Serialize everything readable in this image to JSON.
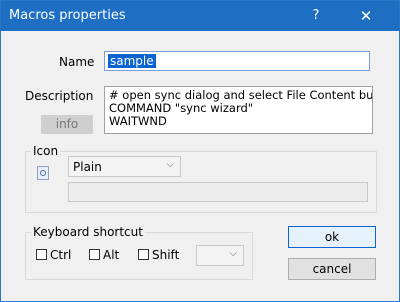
{
  "window": {
    "title": "Macros properties",
    "help_glyph": "?",
    "close_glyph": "✕"
  },
  "name": {
    "label": "Name",
    "value": "sample"
  },
  "description": {
    "label": "Description",
    "text": "# open sync dialog and select File Content butto\nCOMMAND \"sync wizard\"\nWAITWND",
    "info_label": "info"
  },
  "icon": {
    "label": "Icon",
    "icon_name": "picture-icon",
    "style_value": "Plain",
    "path_value": ""
  },
  "shortcut": {
    "label": "Keyboard shortcut",
    "ctrl_label": "Ctrl",
    "alt_label": "Alt",
    "shift_label": "Shift",
    "ctrl_checked": false,
    "alt_checked": false,
    "shift_checked": false,
    "key_value": ""
  },
  "buttons": {
    "ok": "ok",
    "cancel": "cancel"
  },
  "colors": {
    "titlebar": "#1e6fc4",
    "selection": "#0a64d2",
    "dialog_bg": "#f0f0f0"
  }
}
